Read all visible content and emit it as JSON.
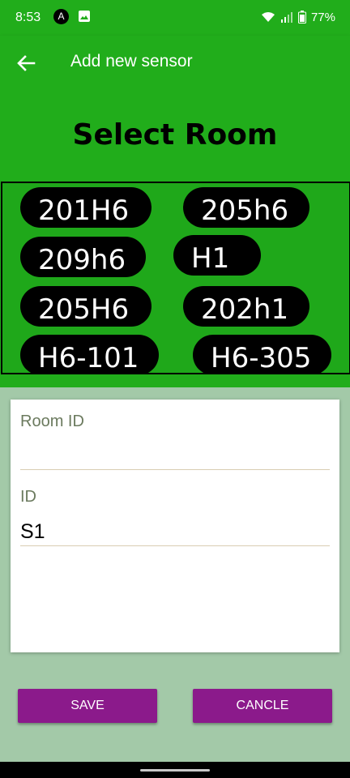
{
  "status_bar": {
    "time": "8:53",
    "app_icon": "A",
    "battery": "77%"
  },
  "app_bar": {
    "title": "Add new sensor"
  },
  "header": {
    "title": "Select Room"
  },
  "rooms": [
    "201H6",
    "205h6",
    "209h6",
    "H1",
    "205H6",
    "202h1",
    "H6-101",
    "H6-305"
  ],
  "form": {
    "room_id": {
      "label": "Room ID",
      "value": ""
    },
    "id": {
      "label": "ID",
      "value": "S1"
    }
  },
  "buttons": {
    "save": "SAVE",
    "cancel": "CANCLE"
  },
  "colors": {
    "primary_green": "#21ad1b",
    "button_purple": "#8b1a8b",
    "background": "#a3c9a8"
  }
}
